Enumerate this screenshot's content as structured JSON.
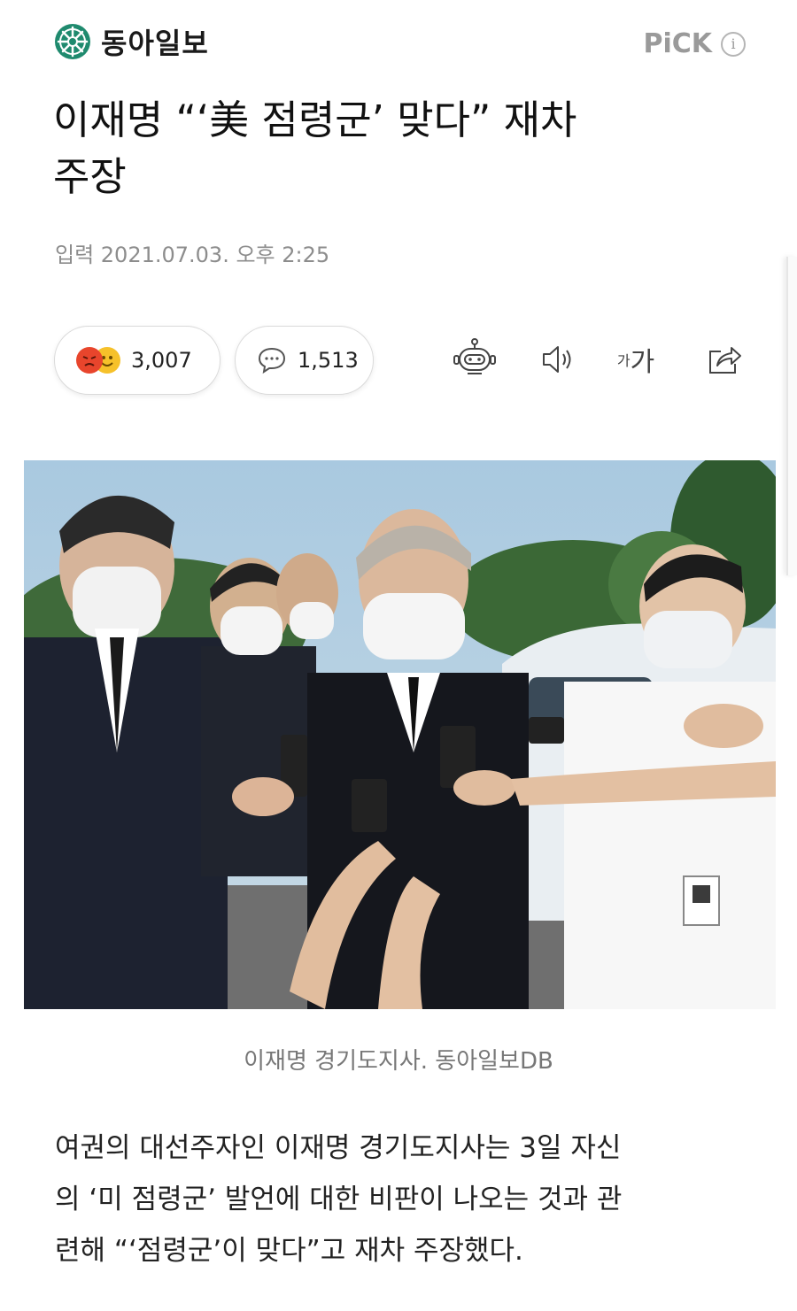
{
  "header": {
    "logo_text": "동아일보",
    "pick_label": "PiCK",
    "info_icon": "info-icon"
  },
  "article": {
    "title_line1": "이재명 “‘美 점령군’ 맞다” 재차",
    "title_line2": "주장",
    "date": "입력 2021.07.03. 오후 2:25"
  },
  "actions": {
    "reactions_count": "3,007",
    "comments_count": "1,513",
    "icons": [
      "robot-summary-icon",
      "speaker-icon",
      "font-size-icon",
      "share-icon"
    ],
    "font_small": "가",
    "font_big": "가"
  },
  "photo": {
    "caption": "이재명 경기도지사. 동아일보DB"
  },
  "body": {
    "line1": "여권의 대선주자인 이재명 경기도지사는 3일 자신",
    "line2": "의 ‘미 점령군’ 발언에 대한 비판이 나오는 것과 관",
    "line3": "련해 “‘점령군’이 맞다”고 재차 주장했다."
  },
  "colors": {
    "logo_green": "#1f8a6e",
    "angry": "#e8452c",
    "happy": "#f6c12a",
    "muted": "#8d8d8d"
  }
}
